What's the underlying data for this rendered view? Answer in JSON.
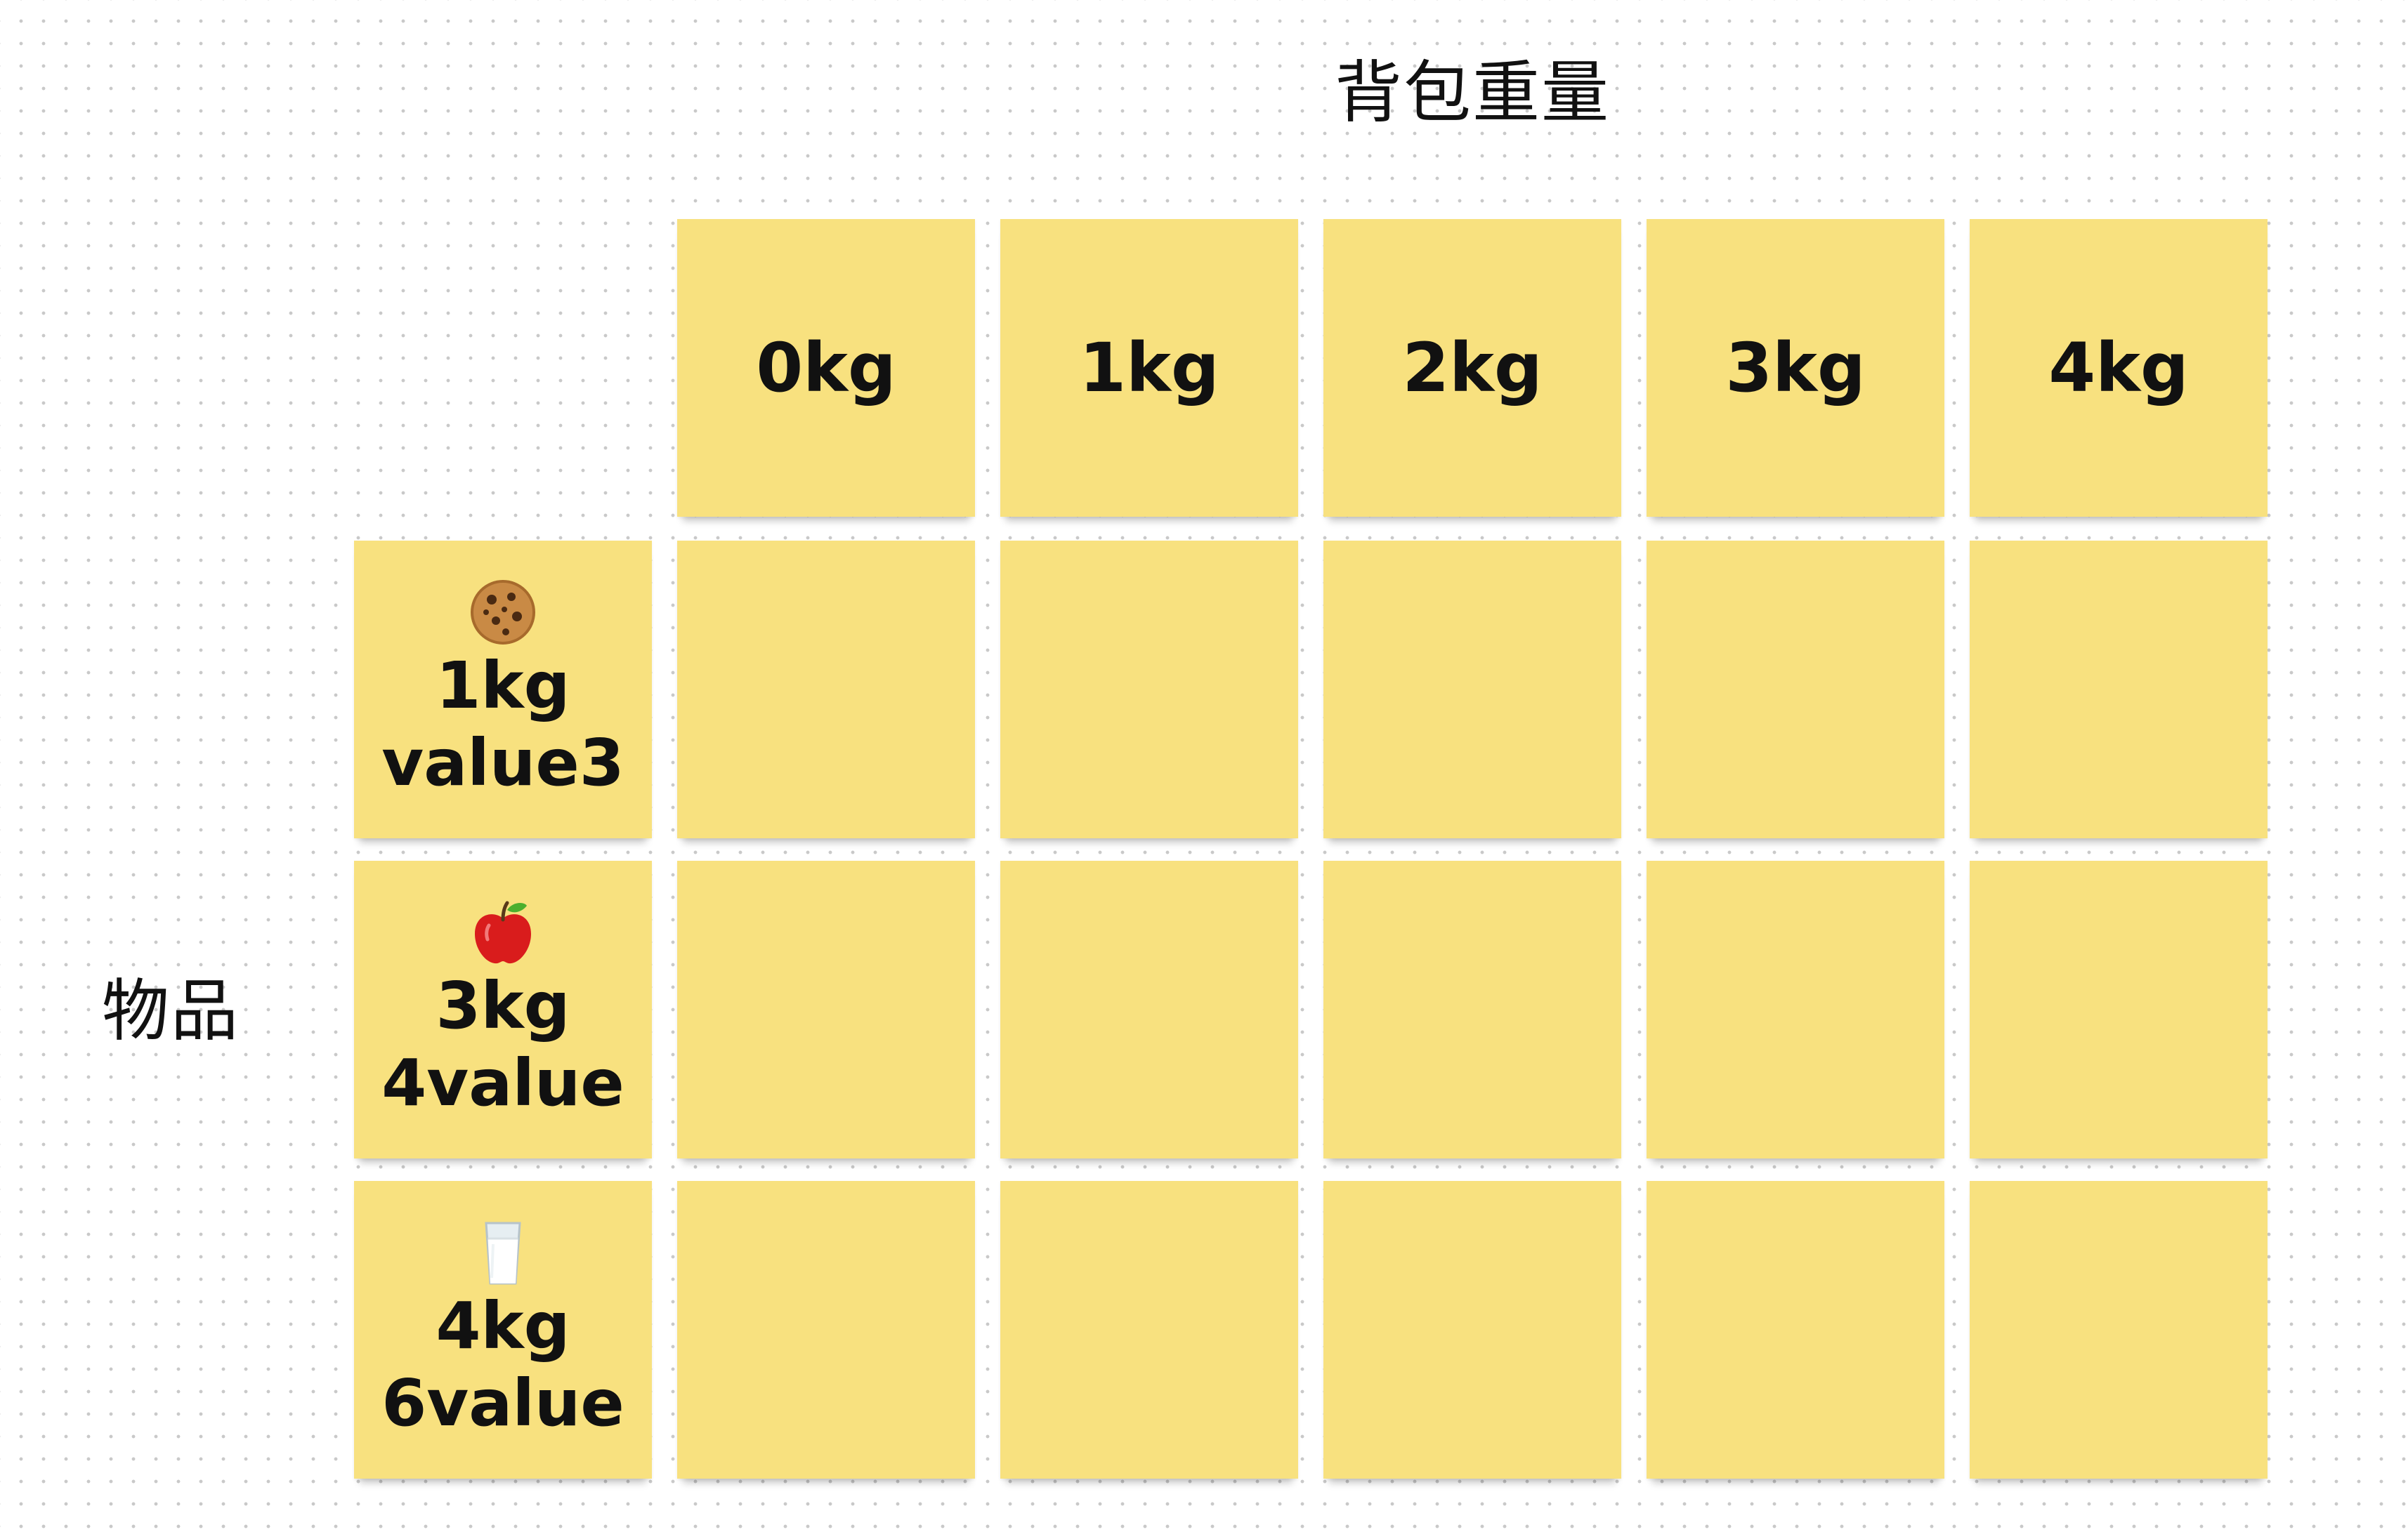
{
  "board": {
    "title": "背包重量",
    "row_axis_label": "物品"
  },
  "weight_headers": [
    "0kg",
    "1kg",
    "2kg",
    "3kg",
    "4kg"
  ],
  "items": [
    {
      "icon": "cookie-icon",
      "weight": "1kg",
      "value": "value3"
    },
    {
      "icon": "apple-icon",
      "weight": "3kg",
      "value": "4value"
    },
    {
      "icon": "milk-glass-icon",
      "weight": "4kg",
      "value": "6value"
    }
  ],
  "colors": {
    "sticky_note": "#f8e17f",
    "text": "#111111",
    "background_dot": "#c9c9c9"
  }
}
